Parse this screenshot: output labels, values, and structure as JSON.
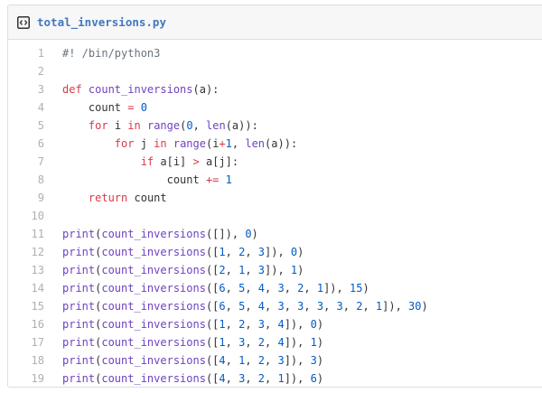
{
  "file": {
    "name": "total_inversions.py",
    "icon": "code-file-icon"
  },
  "colors": {
    "keyword": "#d73a49",
    "function": "#6f42c1",
    "number": "#005cc5",
    "comment": "#6a737d",
    "text": "#333333",
    "filename": "#4078c0",
    "line_number": "#b0b0b0"
  },
  "lines": [
    {
      "num": "1",
      "tokens": [
        {
          "t": "c",
          "v": "#! /bin/python3"
        }
      ]
    },
    {
      "num": "2",
      "tokens": []
    },
    {
      "num": "3",
      "tokens": [
        {
          "t": "k",
          "v": "def "
        },
        {
          "t": "f",
          "v": "count_inversions"
        },
        {
          "t": "t",
          "v": "(a):"
        }
      ]
    },
    {
      "num": "4",
      "tokens": [
        {
          "t": "t",
          "v": "    count "
        },
        {
          "t": "k",
          "v": "="
        },
        {
          "t": "t",
          "v": " "
        },
        {
          "t": "n",
          "v": "0"
        }
      ]
    },
    {
      "num": "5",
      "tokens": [
        {
          "t": "t",
          "v": "    "
        },
        {
          "t": "k",
          "v": "for"
        },
        {
          "t": "t",
          "v": " i "
        },
        {
          "t": "k",
          "v": "in"
        },
        {
          "t": "t",
          "v": " "
        },
        {
          "t": "f",
          "v": "range"
        },
        {
          "t": "t",
          "v": "("
        },
        {
          "t": "n",
          "v": "0"
        },
        {
          "t": "t",
          "v": ", "
        },
        {
          "t": "f",
          "v": "len"
        },
        {
          "t": "t",
          "v": "(a)):"
        }
      ]
    },
    {
      "num": "6",
      "tokens": [
        {
          "t": "t",
          "v": "        "
        },
        {
          "t": "k",
          "v": "for"
        },
        {
          "t": "t",
          "v": " j "
        },
        {
          "t": "k",
          "v": "in"
        },
        {
          "t": "t",
          "v": " "
        },
        {
          "t": "f",
          "v": "range"
        },
        {
          "t": "t",
          "v": "(i"
        },
        {
          "t": "k",
          "v": "+"
        },
        {
          "t": "n",
          "v": "1"
        },
        {
          "t": "t",
          "v": ", "
        },
        {
          "t": "f",
          "v": "len"
        },
        {
          "t": "t",
          "v": "(a)):"
        }
      ]
    },
    {
      "num": "7",
      "tokens": [
        {
          "t": "t",
          "v": "            "
        },
        {
          "t": "k",
          "v": "if"
        },
        {
          "t": "t",
          "v": " a[i] "
        },
        {
          "t": "k",
          "v": ">"
        },
        {
          "t": "t",
          "v": " a[j]:"
        }
      ]
    },
    {
      "num": "8",
      "tokens": [
        {
          "t": "t",
          "v": "                count "
        },
        {
          "t": "k",
          "v": "+="
        },
        {
          "t": "t",
          "v": " "
        },
        {
          "t": "n",
          "v": "1"
        }
      ]
    },
    {
      "num": "9",
      "tokens": [
        {
          "t": "t",
          "v": "    "
        },
        {
          "t": "k",
          "v": "return"
        },
        {
          "t": "t",
          "v": " count"
        }
      ]
    },
    {
      "num": "10",
      "tokens": []
    },
    {
      "num": "11",
      "tokens": [
        {
          "t": "f",
          "v": "print"
        },
        {
          "t": "t",
          "v": "("
        },
        {
          "t": "f",
          "v": "count_inversions"
        },
        {
          "t": "t",
          "v": "([]), "
        },
        {
          "t": "n",
          "v": "0"
        },
        {
          "t": "t",
          "v": ")"
        }
      ]
    },
    {
      "num": "12",
      "tokens": [
        {
          "t": "f",
          "v": "print"
        },
        {
          "t": "t",
          "v": "("
        },
        {
          "t": "f",
          "v": "count_inversions"
        },
        {
          "t": "t",
          "v": "(["
        },
        {
          "t": "n",
          "v": "1"
        },
        {
          "t": "t",
          "v": ", "
        },
        {
          "t": "n",
          "v": "2"
        },
        {
          "t": "t",
          "v": ", "
        },
        {
          "t": "n",
          "v": "3"
        },
        {
          "t": "t",
          "v": "]), "
        },
        {
          "t": "n",
          "v": "0"
        },
        {
          "t": "t",
          "v": ")"
        }
      ]
    },
    {
      "num": "13",
      "tokens": [
        {
          "t": "f",
          "v": "print"
        },
        {
          "t": "t",
          "v": "("
        },
        {
          "t": "f",
          "v": "count_inversions"
        },
        {
          "t": "t",
          "v": "(["
        },
        {
          "t": "n",
          "v": "2"
        },
        {
          "t": "t",
          "v": ", "
        },
        {
          "t": "n",
          "v": "1"
        },
        {
          "t": "t",
          "v": ", "
        },
        {
          "t": "n",
          "v": "3"
        },
        {
          "t": "t",
          "v": "]), "
        },
        {
          "t": "n",
          "v": "1"
        },
        {
          "t": "t",
          "v": ")"
        }
      ]
    },
    {
      "num": "14",
      "tokens": [
        {
          "t": "f",
          "v": "print"
        },
        {
          "t": "t",
          "v": "("
        },
        {
          "t": "f",
          "v": "count_inversions"
        },
        {
          "t": "t",
          "v": "(["
        },
        {
          "t": "n",
          "v": "6"
        },
        {
          "t": "t",
          "v": ", "
        },
        {
          "t": "n",
          "v": "5"
        },
        {
          "t": "t",
          "v": ", "
        },
        {
          "t": "n",
          "v": "4"
        },
        {
          "t": "t",
          "v": ", "
        },
        {
          "t": "n",
          "v": "3"
        },
        {
          "t": "t",
          "v": ", "
        },
        {
          "t": "n",
          "v": "2"
        },
        {
          "t": "t",
          "v": ", "
        },
        {
          "t": "n",
          "v": "1"
        },
        {
          "t": "t",
          "v": "]), "
        },
        {
          "t": "n",
          "v": "15"
        },
        {
          "t": "t",
          "v": ")"
        }
      ]
    },
    {
      "num": "15",
      "tokens": [
        {
          "t": "f",
          "v": "print"
        },
        {
          "t": "t",
          "v": "("
        },
        {
          "t": "f",
          "v": "count_inversions"
        },
        {
          "t": "t",
          "v": "(["
        },
        {
          "t": "n",
          "v": "6"
        },
        {
          "t": "t",
          "v": ", "
        },
        {
          "t": "n",
          "v": "5"
        },
        {
          "t": "t",
          "v": ", "
        },
        {
          "t": "n",
          "v": "4"
        },
        {
          "t": "t",
          "v": ", "
        },
        {
          "t": "n",
          "v": "3"
        },
        {
          "t": "t",
          "v": ", "
        },
        {
          "t": "n",
          "v": "3"
        },
        {
          "t": "t",
          "v": ", "
        },
        {
          "t": "n",
          "v": "3"
        },
        {
          "t": "t",
          "v": ", "
        },
        {
          "t": "n",
          "v": "3"
        },
        {
          "t": "t",
          "v": ", "
        },
        {
          "t": "n",
          "v": "2"
        },
        {
          "t": "t",
          "v": ", "
        },
        {
          "t": "n",
          "v": "1"
        },
        {
          "t": "t",
          "v": "]), "
        },
        {
          "t": "n",
          "v": "30"
        },
        {
          "t": "t",
          "v": ")"
        }
      ]
    },
    {
      "num": "16",
      "tokens": [
        {
          "t": "f",
          "v": "print"
        },
        {
          "t": "t",
          "v": "("
        },
        {
          "t": "f",
          "v": "count_inversions"
        },
        {
          "t": "t",
          "v": "(["
        },
        {
          "t": "n",
          "v": "1"
        },
        {
          "t": "t",
          "v": ", "
        },
        {
          "t": "n",
          "v": "2"
        },
        {
          "t": "t",
          "v": ", "
        },
        {
          "t": "n",
          "v": "3"
        },
        {
          "t": "t",
          "v": ", "
        },
        {
          "t": "n",
          "v": "4"
        },
        {
          "t": "t",
          "v": "]), "
        },
        {
          "t": "n",
          "v": "0"
        },
        {
          "t": "t",
          "v": ")"
        }
      ]
    },
    {
      "num": "17",
      "tokens": [
        {
          "t": "f",
          "v": "print"
        },
        {
          "t": "t",
          "v": "("
        },
        {
          "t": "f",
          "v": "count_inversions"
        },
        {
          "t": "t",
          "v": "(["
        },
        {
          "t": "n",
          "v": "1"
        },
        {
          "t": "t",
          "v": ", "
        },
        {
          "t": "n",
          "v": "3"
        },
        {
          "t": "t",
          "v": ", "
        },
        {
          "t": "n",
          "v": "2"
        },
        {
          "t": "t",
          "v": ", "
        },
        {
          "t": "n",
          "v": "4"
        },
        {
          "t": "t",
          "v": "]), "
        },
        {
          "t": "n",
          "v": "1"
        },
        {
          "t": "t",
          "v": ")"
        }
      ]
    },
    {
      "num": "18",
      "tokens": [
        {
          "t": "f",
          "v": "print"
        },
        {
          "t": "t",
          "v": "("
        },
        {
          "t": "f",
          "v": "count_inversions"
        },
        {
          "t": "t",
          "v": "(["
        },
        {
          "t": "n",
          "v": "4"
        },
        {
          "t": "t",
          "v": ", "
        },
        {
          "t": "n",
          "v": "1"
        },
        {
          "t": "t",
          "v": ", "
        },
        {
          "t": "n",
          "v": "2"
        },
        {
          "t": "t",
          "v": ", "
        },
        {
          "t": "n",
          "v": "3"
        },
        {
          "t": "t",
          "v": "]), "
        },
        {
          "t": "n",
          "v": "3"
        },
        {
          "t": "t",
          "v": ")"
        }
      ]
    },
    {
      "num": "19",
      "tokens": [
        {
          "t": "f",
          "v": "print"
        },
        {
          "t": "t",
          "v": "("
        },
        {
          "t": "f",
          "v": "count_inversions"
        },
        {
          "t": "t",
          "v": "(["
        },
        {
          "t": "n",
          "v": "4"
        },
        {
          "t": "t",
          "v": ", "
        },
        {
          "t": "n",
          "v": "3"
        },
        {
          "t": "t",
          "v": ", "
        },
        {
          "t": "n",
          "v": "2"
        },
        {
          "t": "t",
          "v": ", "
        },
        {
          "t": "n",
          "v": "1"
        },
        {
          "t": "t",
          "v": "]), "
        },
        {
          "t": "n",
          "v": "6"
        },
        {
          "t": "t",
          "v": ")"
        }
      ]
    }
  ]
}
